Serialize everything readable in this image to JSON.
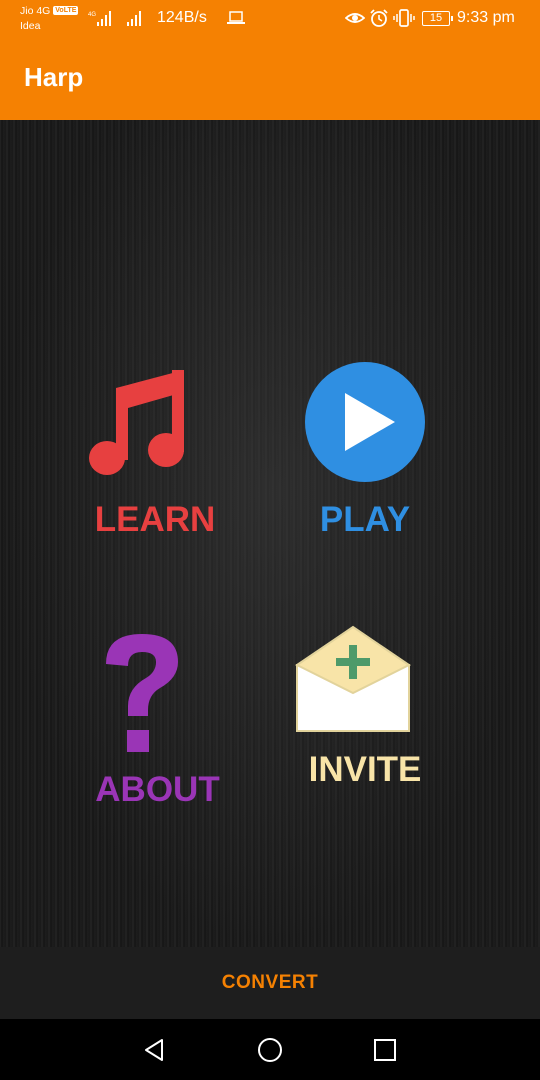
{
  "status_bar": {
    "carrier_line1": "Jio 4G",
    "volte": "VoLTE",
    "carrier_line2": "Idea",
    "net_speed": "124B/s",
    "battery": "15",
    "time": "9:33 pm",
    "icons": [
      "signal-icon",
      "signal-icon",
      "laptop-icon",
      "eye-icon",
      "alarm-icon",
      "vibrate-icon",
      "battery-icon"
    ]
  },
  "app_bar": {
    "title": "Harp"
  },
  "menu": {
    "learn": {
      "label": "LEARN",
      "icon": "music-note-icon",
      "color": "#E74040"
    },
    "play": {
      "label": "PLAY",
      "icon": "play-icon",
      "color": "#2F8FE2"
    },
    "about": {
      "label": "ABOUT",
      "icon": "question-mark-icon",
      "color": "#9A35B6"
    },
    "invite": {
      "label": "INVITE",
      "icon": "envelope-add-icon",
      "color": "#F8E4A8"
    }
  },
  "bottom_bar": {
    "convert_label": "CONVERT"
  },
  "nav_bar": {
    "buttons": [
      "back-icon",
      "home-icon",
      "recents-icon"
    ]
  },
  "colors": {
    "accent": "#F58102"
  }
}
